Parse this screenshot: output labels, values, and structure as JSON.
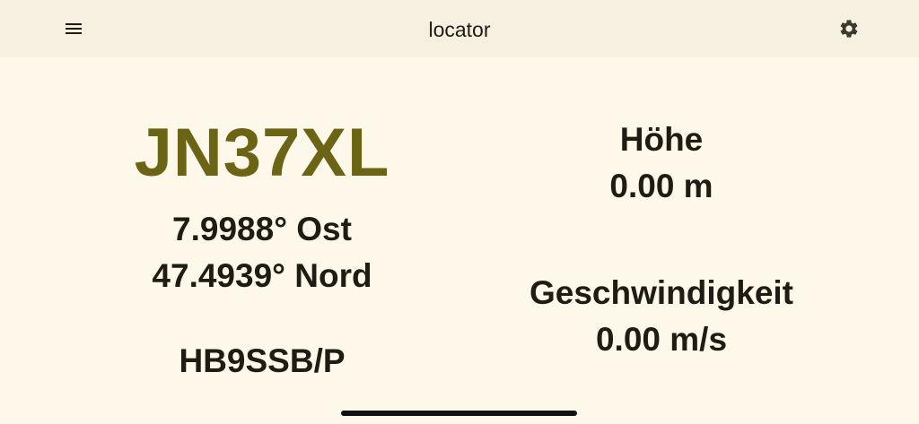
{
  "appbar": {
    "title": "locator",
    "menu_icon": "menu-icon",
    "settings_icon": "gear-icon"
  },
  "position": {
    "locator": "JN37XL",
    "longitude": "7.9988° Ost",
    "latitude": "47.4939° Nord",
    "callsign": "HB9SSB/P"
  },
  "stats": {
    "altitude_label": "Höhe",
    "altitude_value": "0.00 m",
    "speed_label": "Geschwindigkeit",
    "speed_value": "0.00 m/s"
  },
  "colors": {
    "background": "#fdf8ea",
    "appbar": "#f5f0df",
    "accent": "#6b6414",
    "text": "#1f1c14"
  }
}
